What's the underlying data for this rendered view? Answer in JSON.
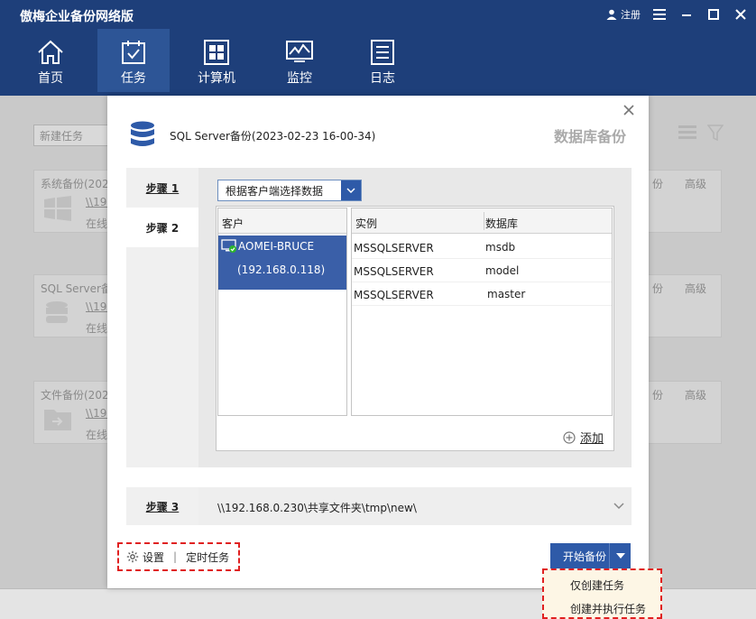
{
  "app": {
    "title": "傲梅企业备份网络版",
    "login_label": "注册"
  },
  "nav": {
    "items": [
      {
        "label": "首页"
      },
      {
        "label": "任务"
      },
      {
        "label": "计算机"
      },
      {
        "label": "监控"
      },
      {
        "label": "日志"
      }
    ]
  },
  "background": {
    "new_task_placeholder": "新建任务",
    "cards": [
      {
        "title": "系统备份(202",
        "link": "\\\\192",
        "status": "在线"
      },
      {
        "title": "SQL Server备",
        "link": "\\\\192",
        "status": "在线"
      },
      {
        "title": "文件备份(202",
        "link": "\\\\192",
        "status": "在线"
      }
    ],
    "right_menu": {
      "m1": "份",
      "m2": "高级"
    }
  },
  "dialog": {
    "task_name": "SQL Server备份(2023-02-23 16-00-34)",
    "type_label": "数据库备份",
    "step1": "步骤 1",
    "step2": "步骤 2",
    "step3": "步骤 3",
    "select_value": "根据客户端选择数据",
    "table": {
      "client_header": "客户",
      "instance_header": "实例",
      "database_header": "数据库",
      "client": {
        "name": "AOMEI-BRUCE",
        "ip": "(192.168.0.118)"
      },
      "rows": [
        {
          "instance": "MSSQLSERVER",
          "database": "msdb"
        },
        {
          "instance": "MSSQLSERVER",
          "database": "model"
        },
        {
          "instance": "MSSQLSERVER",
          "database": "master"
        }
      ]
    },
    "add_label": "添加",
    "dest_path": "\\\\192.168.0.230\\共享文件夹\\tmp\\new\\",
    "settings_label": "设置",
    "schedule_label": "定时任务",
    "start_label": "开始备份"
  },
  "dropdown": {
    "create_only": "仅创建任务",
    "create_and_run": "创建并执行任务"
  },
  "colors": {
    "titlebar": "#1e3f7a",
    "accent": "#2e5aa8",
    "highlight_border": "#e02020"
  }
}
